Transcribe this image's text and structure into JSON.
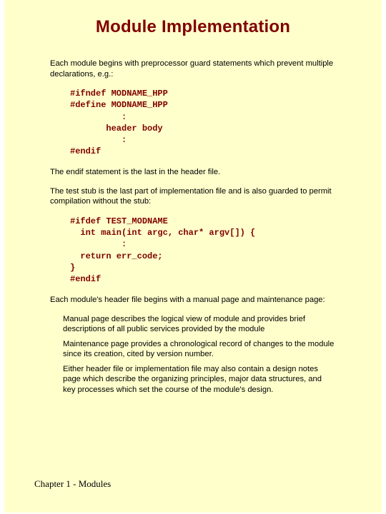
{
  "title": "Module Implementation",
  "para1": "Each module begins with preprocessor guard statements which prevent multiple declarations, e.g.:",
  "code1": "#ifndef MODNAME_HPP\n#define MODNAME_HPP\n          :\n       header body\n          :\n#endif",
  "para2": "The endif statement is the last in the header file.",
  "para3": "The test stub is the last part of implementation file and is also guarded to permit compilation without the stub:",
  "code2": "#ifdef TEST_MODNAME\n  int main(int argc, char* argv[]) {\n          :\n  return err_code;\n}\n#endif",
  "para4": "Each module's header file begins with a manual page and maintenance page:",
  "bullets": [
    "Manual page describes the logical view of module and provides brief descriptions of all public services provided by the module",
    "Maintenance page provides a chronological record of changes to the module since its creation, cited by version number.",
    "Either header file or implementation file may also contain a design notes page which describe the organizing principles, major data structures, and key processes which set the course of the module's design."
  ],
  "footer": "Chapter 1 - Modules"
}
